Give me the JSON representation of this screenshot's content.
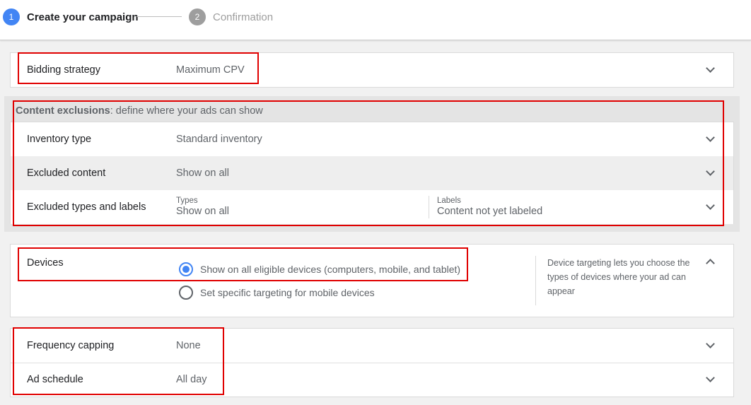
{
  "stepper": {
    "step1": {
      "number": "1",
      "label": "Create your campaign"
    },
    "step2": {
      "number": "2",
      "label": "Confirmation"
    }
  },
  "bidding": {
    "label": "Bidding strategy",
    "value": "Maximum CPV"
  },
  "content_exclusions": {
    "title_bold": "Content exclusions",
    "title_rest": ": define where your ads can show",
    "inventory": {
      "label": "Inventory type",
      "value": "Standard inventory"
    },
    "excluded_content": {
      "label": "Excluded content",
      "value": "Show on all"
    },
    "excluded_types": {
      "label": "Excluded types and labels",
      "types_label": "Types",
      "types_value": "Show on all",
      "labels_label": "Labels",
      "labels_value": "Content not yet labeled"
    }
  },
  "devices": {
    "label": "Devices",
    "option_all": "Show on all eligible devices (computers, mobile, and tablet)",
    "option_specific": "Set specific targeting for mobile devices",
    "selected": "option_all",
    "help": "Device targeting lets you choose the types of devices where your ad can appear"
  },
  "frequency": {
    "label": "Frequency capping",
    "value": "None"
  },
  "schedule": {
    "label": "Ad schedule",
    "value": "All day"
  },
  "colors": {
    "accent": "#4285f4",
    "highlight": "#e00000"
  }
}
